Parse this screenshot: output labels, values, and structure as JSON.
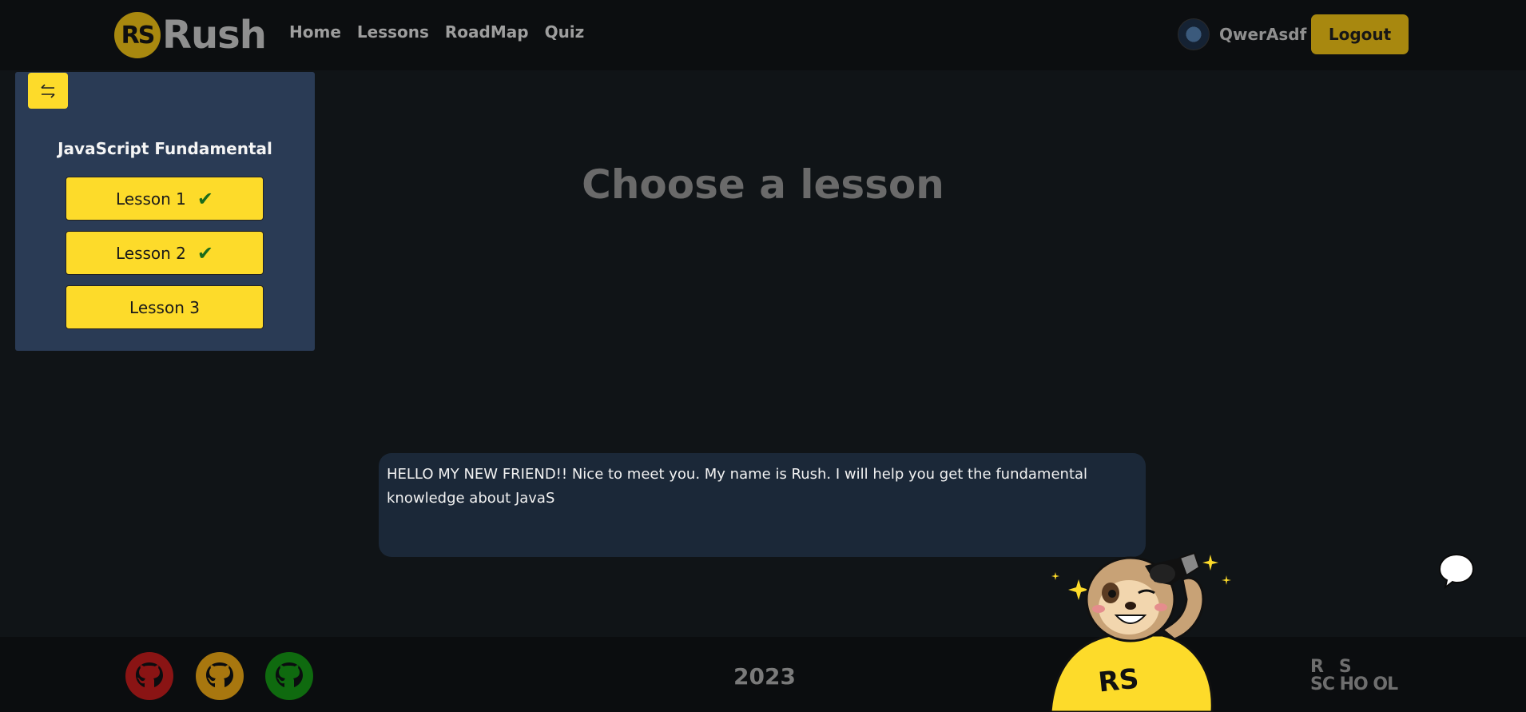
{
  "header": {
    "logo_mark": "RS",
    "logo_text": "Rush",
    "nav": [
      "Home",
      "Lessons",
      "RoadMap",
      "Quiz"
    ],
    "username": "QwerAsdf",
    "logout_label": "Logout"
  },
  "sidebar": {
    "toggle_icon": "swap-arrows-icon",
    "course_title": "JavaScript Fundamental",
    "lessons": [
      {
        "label": "Lesson 1",
        "completed": true
      },
      {
        "label": "Lesson 2",
        "completed": true
      },
      {
        "label": "Lesson 3",
        "completed": false
      }
    ]
  },
  "main": {
    "heading": "Choose a lesson",
    "bubble_text": "HELLO MY NEW FRIEND!! Nice to meet you. My name is Rush. I will help you get the fundamental knowledge about JavaS"
  },
  "footer": {
    "year": "2023",
    "github_icons": [
      "#8a1414",
      "#a8770f",
      "#0f6a0f"
    ],
    "rs_school_line1": "R   S",
    "rs_school_line2": "SC HO OL"
  },
  "colors": {
    "accent": "#fddb2a",
    "accent_dim": "#a8880f",
    "sidebar_bg": "#2a3b55",
    "bubble_bg": "#1b2838",
    "check": "#1b6b1b"
  }
}
